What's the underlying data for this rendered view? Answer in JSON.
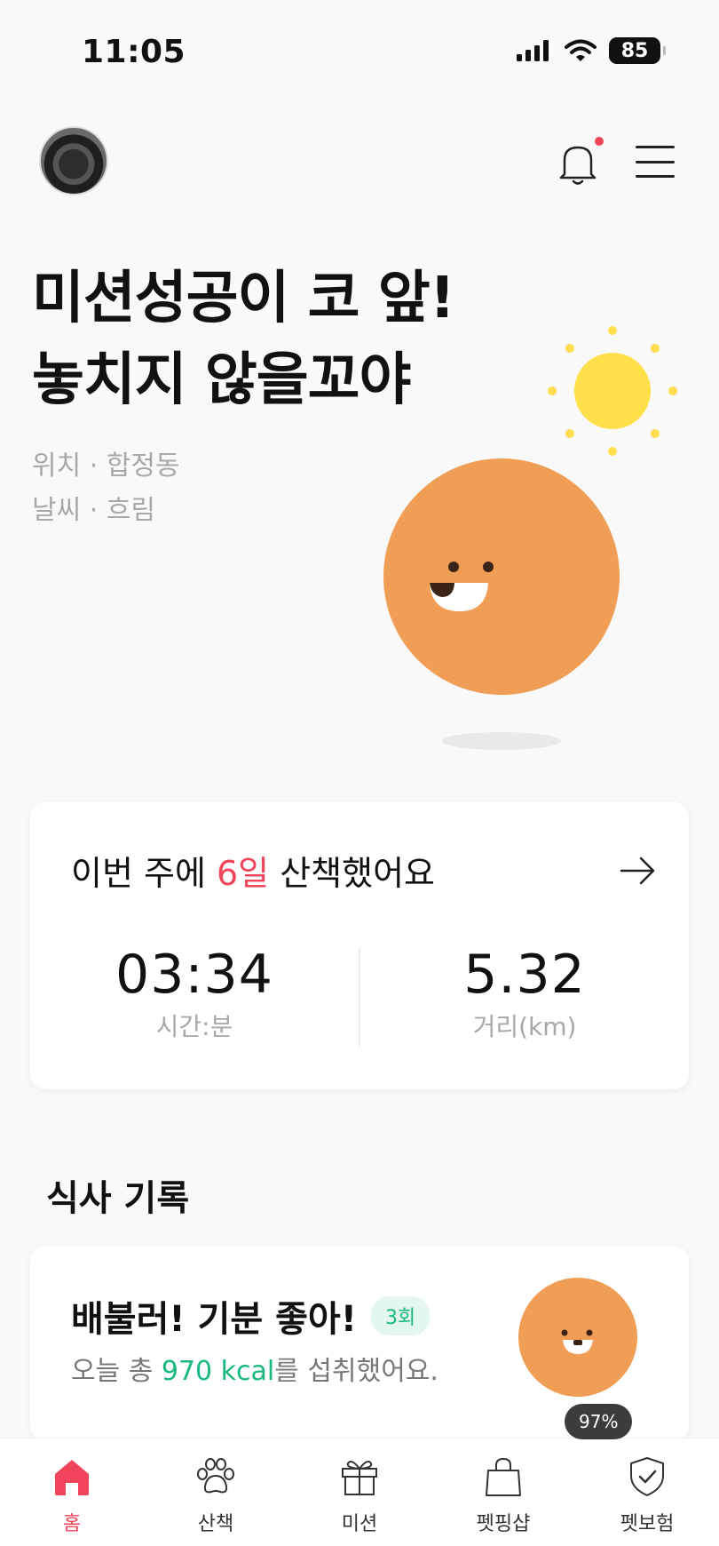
{
  "status": {
    "time": "11:05",
    "battery": "85"
  },
  "header": {
    "avatar_icon": "dog-avatar",
    "bell_icon": "bell-icon",
    "menu_icon": "hamburger-menu-icon"
  },
  "hero": {
    "title_line1": "미션성공이 코 앞!",
    "title_line2": "놓치지 않을꼬야",
    "location": "위치 · 합정동",
    "weather": "날씨 · 흐림"
  },
  "weekly": {
    "prefix": "이번 주에 ",
    "days": "6일",
    "suffix": " 산책했어요",
    "time_value": "03:34",
    "time_label": "시간:분",
    "distance_value": "5.32",
    "distance_label": "거리(km)"
  },
  "meal": {
    "section_title": "식사 기록",
    "title": "배불러! 기분 좋아!",
    "count": "3회",
    "desc_prefix": "오늘 총 ",
    "kcal": "970 kcal",
    "desc_suffix": "를 섭취했어요.",
    "percent": "97%"
  },
  "nav": [
    {
      "label": "홈",
      "icon": "home-icon"
    },
    {
      "label": "산책",
      "icon": "paw-icon"
    },
    {
      "label": "미션",
      "icon": "gift-icon"
    },
    {
      "label": "펫핑샵",
      "icon": "shopping-bag-icon"
    },
    {
      "label": "펫보험",
      "icon": "shield-check-icon"
    }
  ],
  "colors": {
    "accent": "#f0455a",
    "green": "#19b97c",
    "character": "#f09e55",
    "sun": "#ffe04a"
  }
}
